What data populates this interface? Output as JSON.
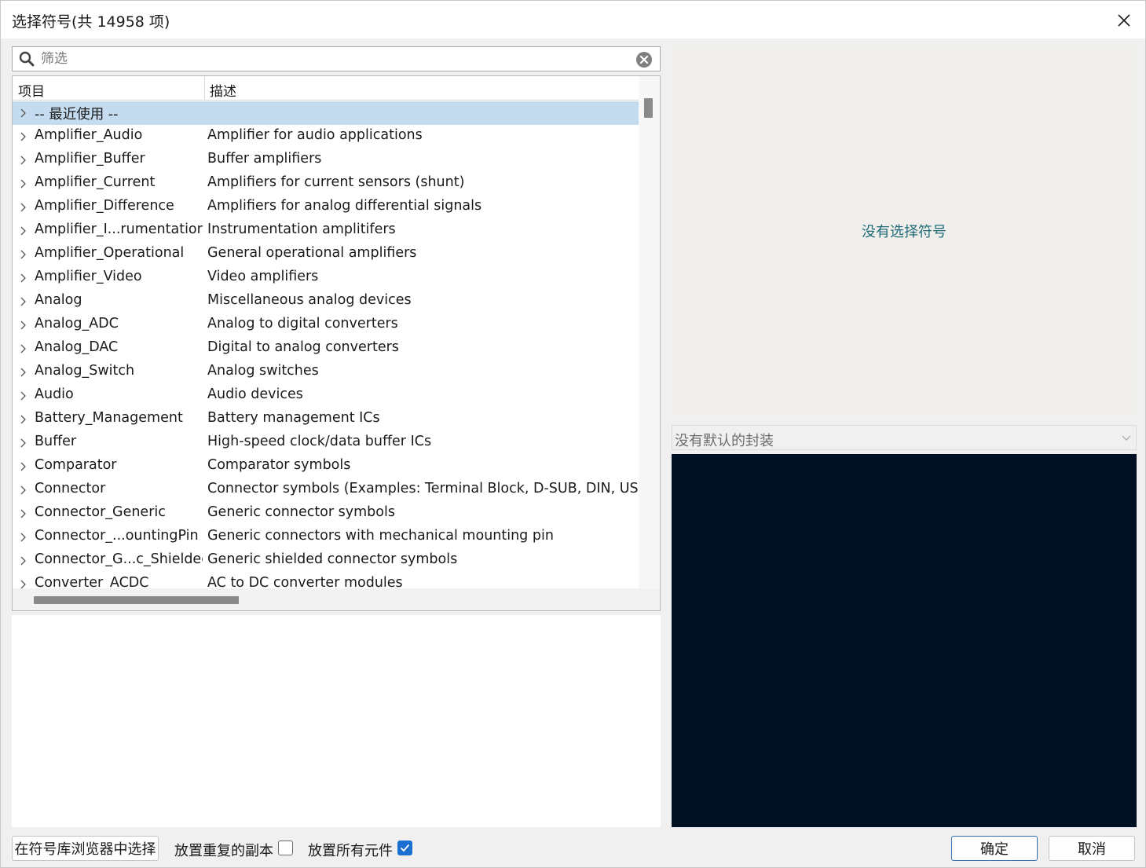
{
  "window": {
    "title": "选择符号(共 14958 项)"
  },
  "search": {
    "placeholder": "筛选",
    "value": ""
  },
  "tree": {
    "columns": [
      "项目",
      "描述"
    ],
    "rows": [
      {
        "name": "-- 最近使用 --",
        "desc": "",
        "selected": true
      },
      {
        "name": "Amplifier_Audio",
        "desc": "Amplifier for audio applications"
      },
      {
        "name": "Amplifier_Buffer",
        "desc": "Buffer amplifiers"
      },
      {
        "name": "Amplifier_Current",
        "desc": "Amplifiers for current sensors (shunt)"
      },
      {
        "name": "Amplifier_Difference",
        "desc": "Amplifiers for analog differential signals"
      },
      {
        "name": "Amplifier_I...rumentation",
        "desc": "Instrumentation amplitifers"
      },
      {
        "name": "Amplifier_Operational",
        "desc": "General operational amplifiers"
      },
      {
        "name": "Amplifier_Video",
        "desc": "Video amplifiers"
      },
      {
        "name": "Analog",
        "desc": "Miscellaneous analog devices"
      },
      {
        "name": "Analog_ADC",
        "desc": "Analog to digital converters"
      },
      {
        "name": "Analog_DAC",
        "desc": "Digital to analog converters"
      },
      {
        "name": "Analog_Switch",
        "desc": "Analog switches"
      },
      {
        "name": "Audio",
        "desc": "Audio devices"
      },
      {
        "name": "Battery_Management",
        "desc": "Battery management ICs"
      },
      {
        "name": "Buffer",
        "desc": "High-speed clock/data buffer ICs"
      },
      {
        "name": "Comparator",
        "desc": "Comparator symbols"
      },
      {
        "name": "Connector",
        "desc": "Connector symbols (Examples: Terminal Block, D-SUB, DIN, USB."
      },
      {
        "name": "Connector_Generic",
        "desc": "Generic connector symbols"
      },
      {
        "name": "Connector_...ountingPin",
        "desc": "Generic connectors with mechanical mounting pin"
      },
      {
        "name": "Connector_G...c_Shielded",
        "desc": "Generic shielded connector symbols"
      },
      {
        "name": "Converter_ACDC",
        "desc": "AC to DC converter modules"
      }
    ]
  },
  "preview": {
    "no_symbol_text": "没有选择符号"
  },
  "footprint": {
    "selected": "没有默认的封装"
  },
  "bottom": {
    "browse_label": "在符号库浏览器中选择",
    "place_repeated_label": "放置重复的副本",
    "place_repeated_checked": false,
    "place_all_label": "放置所有元件",
    "place_all_checked": true,
    "ok_label": "确定",
    "cancel_label": "取消"
  },
  "colors": {
    "selection": "#c5dcf0",
    "footprint_bg": "#001023",
    "accent": "#1a6fd0",
    "preview_text": "#1f6b78"
  }
}
